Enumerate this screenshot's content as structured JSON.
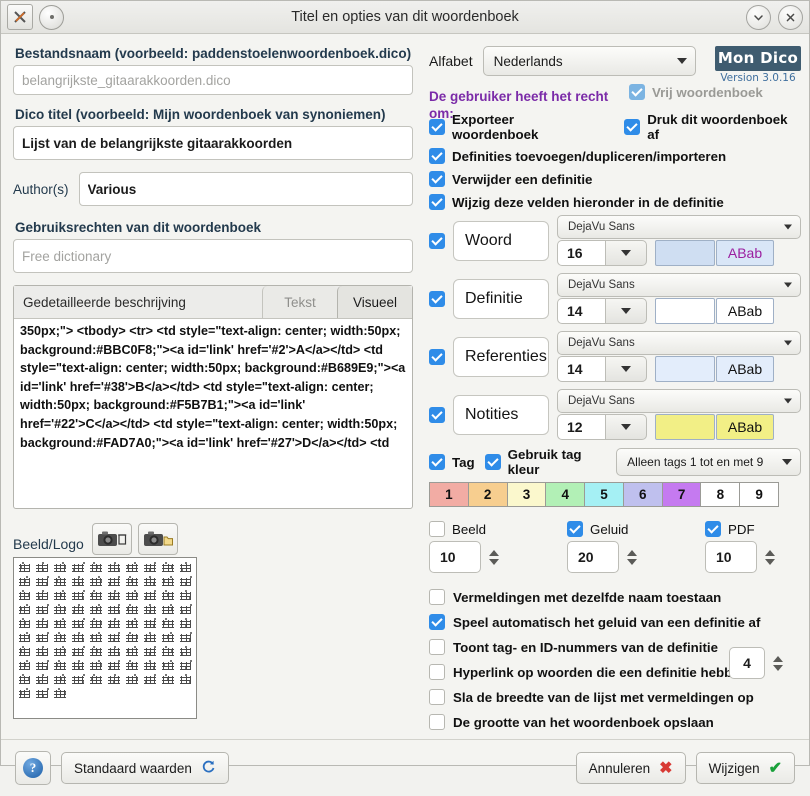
{
  "window": {
    "title": "Titel en opties van dit woordenboek",
    "minimize_icon": "chevron-down-icon",
    "close_icon": "close-icon",
    "app_icon": "x-app-icon"
  },
  "left": {
    "filename_label": "Bestandsnaam (voorbeeld: paddenstoelenwoordenboek.dico)",
    "filename_placeholder": "belangrijkste_gitaarakkoorden.dico",
    "filename_value": "",
    "title_label": "Dico titel (voorbeeld: Mijn woordenboek van synoniemen)",
    "title_value": "Lijst van de belangrijkste gitaarakkoorden",
    "author_label": "Author(s)",
    "author_value": "Various",
    "rights_label": "Gebruiksrechten van dit woordenboek",
    "rights_placeholder": "Free dictionary",
    "rights_value": "",
    "desc_title": "Gedetailleerde beschrijving",
    "tab_text": "Tekst",
    "tab_visual": "Visueel",
    "desc_body": "350px;\"> <tbody> <tr> <td style=\"text-align: center; width:50px; background:#BBC0F8;\"><a id='link' href='#2'>A</a></td> <td style=\"text-align: center; width:50px; background:#B689E9;\"><a id='link' href='#38'>B</a></td> <td style=\"text-align: center; width:50px; background:#F5B7B1;\"><a id='link' href='#22'>C</a></td> <td style=\"text-align: center; width:50px; background:#FAD7A0;\"><a id='link' href='#27'>D</a></td> <td",
    "logo_label": "Beeld/Logo",
    "cam_delete_icon": "camera-delete-icon",
    "cam_open_icon": "camera-open-icon"
  },
  "right": {
    "alphabet_label": "Alfabet",
    "alphabet_value": "Nederlands",
    "brand_name": "Mon Dico",
    "brand_version": "Version 3.0.16",
    "rights_header": "De gebruiker heeft het recht om:",
    "free_dict_label": "Vrij woordenboek",
    "free_dict_checked": true,
    "permissions": [
      {
        "label": "Exporteer woordenboek",
        "checked": true
      },
      {
        "label": "Druk dit woordenboek af",
        "checked": true
      },
      {
        "label": "Definities toevoegen/dupliceren/importeren",
        "checked": true
      },
      {
        "label": "Verwijder een definitie",
        "checked": true
      },
      {
        "label": "Wijzig deze velden hieronder in de definitie",
        "checked": true
      }
    ],
    "font_rows": [
      {
        "checked": true,
        "name": "Woord",
        "family": "DejaVu Sans",
        "size": "16",
        "swatch": "#cfdef2",
        "sample": "ABab",
        "sample_color": "#9b1fa0",
        "sample_bg": "#d9e6f7"
      },
      {
        "checked": true,
        "name": "Definitie",
        "family": "DejaVu Sans",
        "size": "14",
        "swatch": "#ffffff",
        "sample": "ABab",
        "sample_color": "#111111",
        "sample_bg": "#ffffff"
      },
      {
        "checked": true,
        "name": "Referenties",
        "family": "DejaVu Sans",
        "size": "14",
        "swatch": "#e3edfb",
        "sample": "ABab",
        "sample_color": "#111111",
        "sample_bg": "#e3edfb"
      },
      {
        "checked": true,
        "name": "Notities",
        "family": "DejaVu Sans",
        "size": "12",
        "swatch": "#f2ef86",
        "sample": "ABab",
        "sample_color": "#111111",
        "sample_bg": "#f2ef86"
      }
    ],
    "tag_label": "Tag",
    "tag_checked": true,
    "tag_color_label": "Gebruik tag kleur",
    "tag_color_checked": true,
    "tag_range_value": "Alleen tags 1 tot en met 9",
    "tags": [
      {
        "n": "1",
        "color": "#f2aca4"
      },
      {
        "n": "2",
        "color": "#f7ce8f"
      },
      {
        "n": "3",
        "color": "#fbf8cd"
      },
      {
        "n": "4",
        "color": "#b2f0b6"
      },
      {
        "n": "5",
        "color": "#a5f0f4"
      },
      {
        "n": "6",
        "color": "#bfc0ee"
      },
      {
        "n": "7",
        "color": "#c57af0"
      },
      {
        "n": "8",
        "color": "#ffffff"
      },
      {
        "n": "9",
        "color": "#ffffff"
      }
    ],
    "media": [
      {
        "label": "Beeld",
        "checked": false,
        "value": "10"
      },
      {
        "label": "Geluid",
        "checked": true,
        "value": "20"
      },
      {
        "label": "PDF",
        "checked": true,
        "value": "10"
      }
    ],
    "options": [
      {
        "label": "Vermeldingen met dezelfde naam toestaan",
        "checked": false
      },
      {
        "label": "Speel automatisch het geluid van een definitie af",
        "checked": true
      },
      {
        "label": "Toont tag- en ID-nummers van de definitie",
        "checked": false
      },
      {
        "label": "Hyperlink op woorden die een definitie hebben",
        "checked": false
      },
      {
        "label": "Sla de breedte van de lijst met vermeldingen op",
        "checked": false
      },
      {
        "label": "De grootte van het woordenboek opslaan",
        "checked": false
      }
    ],
    "hyperlink_depth": "4"
  },
  "footer": {
    "help_label": "?",
    "defaults_label": "Standaard waarden",
    "defaults_icon": "refresh-icon",
    "cancel_label": "Annuleren",
    "cancel_icon": "x-red-icon",
    "apply_label": "Wijzigen",
    "apply_icon": "check-green-icon"
  }
}
